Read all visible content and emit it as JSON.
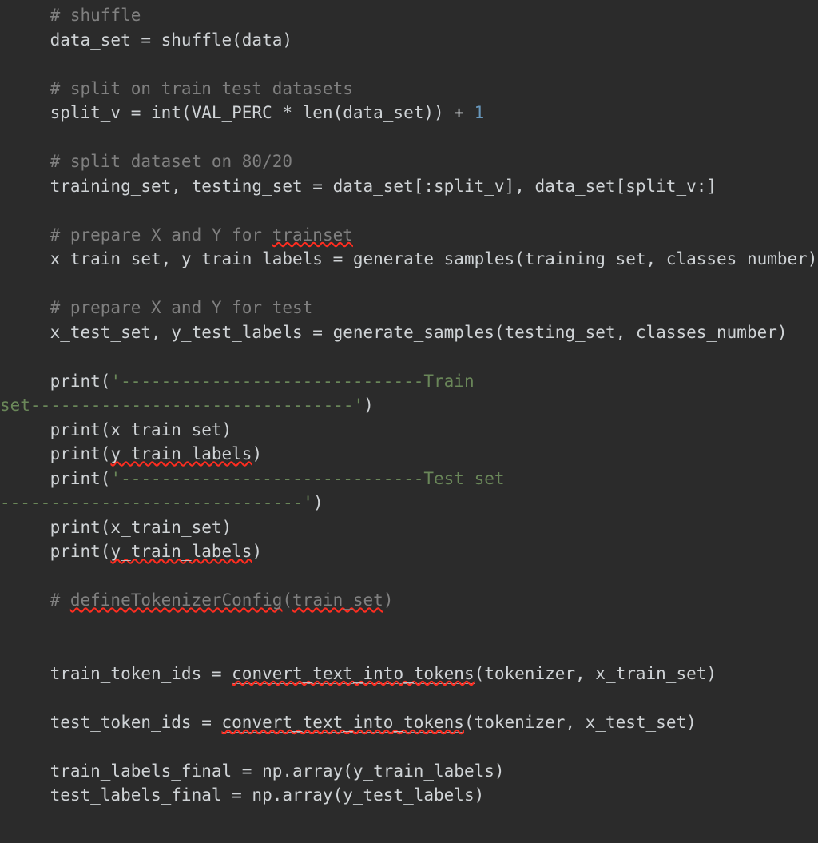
{
  "editor": {
    "theme_name": "darcula",
    "background_color": "#2b2b2b",
    "language": "python",
    "colors": {
      "default_text": "#cfd3d6",
      "comment": "#808080",
      "string": "#6a8759",
      "number": "#6897bb",
      "spellcheck_underline": "#ff2d20",
      "unresolved_underline": "#9aa0a6"
    }
  },
  "code": {
    "lines": [
      {
        "id": "line-comment-shuffle",
        "segments": [
          {
            "text": "    # shuffle",
            "style": "comment"
          }
        ]
      },
      {
        "id": "line-data-set-shuffle",
        "segments": [
          {
            "text": "    data_set = shuffle(data)",
            "style": "default"
          }
        ]
      },
      {
        "id": "line-blank-1",
        "segments": [
          {
            "text": " ",
            "style": "default"
          }
        ]
      },
      {
        "id": "line-comment-split-on",
        "segments": [
          {
            "text": "    # split on train test datasets",
            "style": "comment"
          }
        ]
      },
      {
        "id": "line-split-v",
        "segments": [
          {
            "text": "    split_v = int(VAL_PERC * len(data_set)) + ",
            "style": "default"
          },
          {
            "text": "1",
            "style": "number"
          }
        ]
      },
      {
        "id": "line-blank-2",
        "segments": [
          {
            "text": " ",
            "style": "default"
          }
        ]
      },
      {
        "id": "line-comment-split-8020",
        "segments": [
          {
            "text": "    # split dataset on 80/20",
            "style": "comment"
          }
        ]
      },
      {
        "id": "line-training-testing-set",
        "segments": [
          {
            "text": "    training_set, testing_set = data_set[:split_v], data_set[split_v:]",
            "style": "default"
          }
        ]
      },
      {
        "id": "line-blank-3",
        "segments": [
          {
            "text": " ",
            "style": "default"
          }
        ]
      },
      {
        "id": "line-comment-prepare-trainset",
        "segments": [
          {
            "text": "    # prepare X and Y for ",
            "style": "comment"
          },
          {
            "text": "trainset",
            "style": "comment",
            "spellcheck": true
          }
        ]
      },
      {
        "id": "line-x-train-set",
        "segments": [
          {
            "text": "    x_train_set, y_train_labels = generate_samples(training_set, classes_number)",
            "style": "default"
          }
        ]
      },
      {
        "id": "line-blank-4",
        "segments": [
          {
            "text": " ",
            "style": "default"
          }
        ]
      },
      {
        "id": "line-comment-prepare-test",
        "segments": [
          {
            "text": "    # prepare X and Y for test",
            "style": "comment"
          }
        ]
      },
      {
        "id": "line-x-test-set",
        "segments": [
          {
            "text": "    x_test_set, y_test_labels = generate_samples(testing_set, classes_number)",
            "style": "default"
          }
        ]
      },
      {
        "id": "line-blank-5",
        "segments": [
          {
            "text": " ",
            "style": "default"
          }
        ]
      },
      {
        "id": "line-print-train-set-header",
        "segments": [
          {
            "text": "    print(",
            "style": "default"
          },
          {
            "text": "'------------------------------Train",
            "style": "string"
          }
        ]
      },
      {
        "id": "line-print-train-set-header-wrap",
        "wrapped": true,
        "segments": [
          {
            "text": "set--------------------------------'",
            "style": "string"
          },
          {
            "text": ")",
            "style": "default"
          }
        ]
      },
      {
        "id": "line-print-x-train-set-1",
        "segments": [
          {
            "text": "    print(x_train_set)",
            "style": "default"
          }
        ]
      },
      {
        "id": "line-print-y-train-labels-1",
        "segments": [
          {
            "text": "    print(",
            "style": "default"
          },
          {
            "text": "y_train_labels",
            "style": "default",
            "spellcheck": true
          },
          {
            "text": ")",
            "style": "default"
          }
        ]
      },
      {
        "id": "line-print-test-set-header",
        "segments": [
          {
            "text": "    print(",
            "style": "default"
          },
          {
            "text": "'------------------------------Test set",
            "style": "string"
          }
        ]
      },
      {
        "id": "line-print-test-set-header-wrap",
        "wrapped": true,
        "segments": [
          {
            "text": "------------------------------'",
            "style": "string"
          },
          {
            "text": ")",
            "style": "default"
          }
        ]
      },
      {
        "id": "line-print-x-train-set-2",
        "segments": [
          {
            "text": "    print(x_train_set)",
            "style": "default"
          }
        ]
      },
      {
        "id": "line-print-y-train-labels-2",
        "segments": [
          {
            "text": "    print(",
            "style": "default"
          },
          {
            "text": "y_train_labels",
            "style": "default",
            "spellcheck": true
          },
          {
            "text": ")",
            "style": "default"
          }
        ]
      },
      {
        "id": "line-blank-6",
        "segments": [
          {
            "text": " ",
            "style": "default"
          }
        ]
      },
      {
        "id": "line-comment-define-tokenizer-config",
        "segments": [
          {
            "text": "    # ",
            "style": "comment"
          },
          {
            "text": "defineTokenizerConfig",
            "style": "comment",
            "unresolved": true
          },
          {
            "text": "(",
            "style": "comment"
          },
          {
            "text": "train_set",
            "style": "comment",
            "unresolved": true
          },
          {
            "text": ")",
            "style": "comment"
          }
        ]
      },
      {
        "id": "line-blank-7",
        "segments": [
          {
            "text": " ",
            "style": "default"
          }
        ]
      },
      {
        "id": "line-blank-8",
        "segments": [
          {
            "text": " ",
            "style": "default"
          }
        ]
      },
      {
        "id": "line-train-token-ids",
        "segments": [
          {
            "text": "    train_token_ids = ",
            "style": "default"
          },
          {
            "text": "convert_text_into_tokens",
            "style": "default",
            "unresolved": true
          },
          {
            "text": "(tokenizer, x_train_set)",
            "style": "default"
          }
        ]
      },
      {
        "id": "line-blank-9",
        "segments": [
          {
            "text": " ",
            "style": "default"
          }
        ]
      },
      {
        "id": "line-test-token-ids",
        "segments": [
          {
            "text": "    test_token_ids = ",
            "style": "default"
          },
          {
            "text": "convert_text_into_tokens",
            "style": "default",
            "unresolved": true
          },
          {
            "text": "(tokenizer, x_test_set)",
            "style": "default"
          }
        ]
      },
      {
        "id": "line-blank-10",
        "segments": [
          {
            "text": " ",
            "style": "default"
          }
        ]
      },
      {
        "id": "line-train-labels-final",
        "segments": [
          {
            "text": "    train_labels_final = np.array(y_train_labels)",
            "style": "default"
          }
        ]
      },
      {
        "id": "line-test-labels-final",
        "segments": [
          {
            "text": "    test_labels_final = np.array(y_test_labels)",
            "style": "default"
          }
        ]
      }
    ]
  }
}
